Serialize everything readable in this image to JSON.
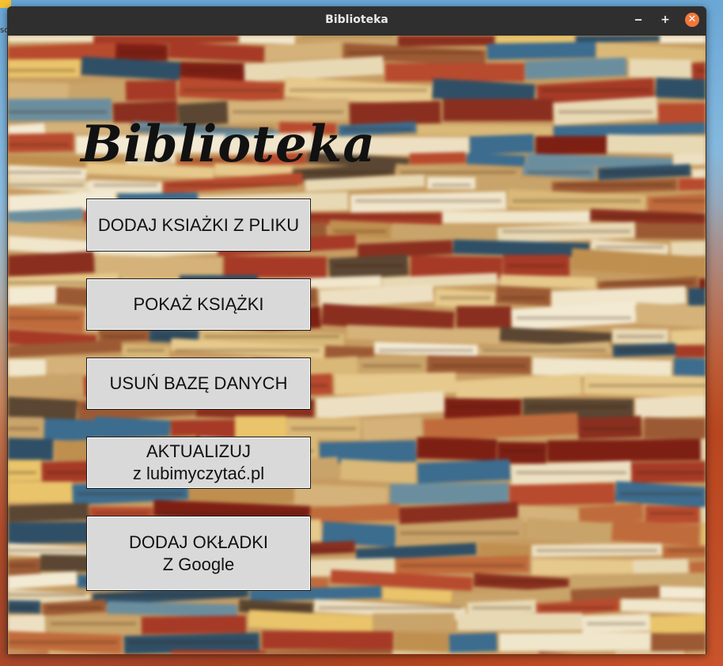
{
  "window": {
    "title": "Biblioteka",
    "minimize_label": "‒",
    "maximize_label": "+",
    "close_label": "✕"
  },
  "app": {
    "heading": "Biblioteka",
    "buttons": [
      {
        "line1": "DODAJ KSIAŻKI Z PLIKU",
        "line2": ""
      },
      {
        "line1": "POKAŻ KSIĄŻKI",
        "line2": ""
      },
      {
        "line1": "USUŃ BAZĘ DANYCH",
        "line2": ""
      },
      {
        "line1": "AKTUALIZUJ",
        "line2": "z lubimyczytać.pl"
      },
      {
        "line1": "DODAJ OKŁADKI",
        "line2": "Z Google"
      }
    ]
  },
  "desktop": {
    "label": "sc"
  },
  "colors": {
    "button_bg": "#d9d9d9",
    "close_button": "#f2773a",
    "titlebar": "#2f2f2f"
  }
}
